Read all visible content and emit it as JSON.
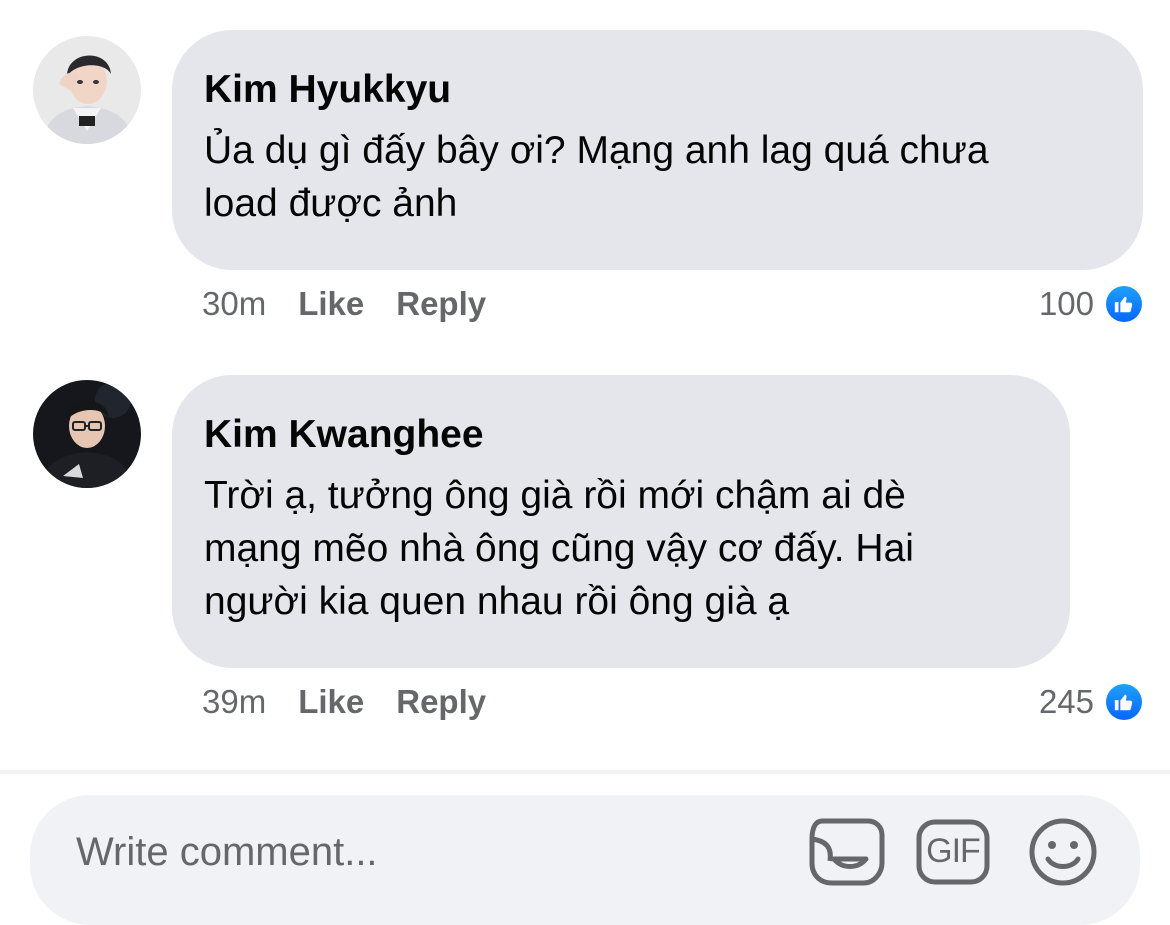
{
  "comments": [
    {
      "author": "Kim Hyukkyu",
      "text_lines": [
        "Ủa dụ gì đấy bây ơi? Mạng anh lag quá chưa",
        "load được ảnh"
      ],
      "time": "30m",
      "like_label": "Like",
      "reply_label": "Reply",
      "reaction_count": "100"
    },
    {
      "author": "Kim Kwanghee",
      "text_lines": [
        "Trời ạ, tưởng ông già rồi mới chậm ai dè",
        "mạng mẽo nhà ông cũng vậy cơ đấy. Hai",
        "người kia quen nhau rồi ông già ạ"
      ],
      "time": "39m",
      "like_label": "Like",
      "reply_label": "Reply",
      "reaction_count": "245"
    }
  ],
  "composer": {
    "placeholder": "Write comment...",
    "icons": [
      "sticker-icon",
      "gif-icon",
      "emoji-icon"
    ],
    "gif_label": "GIF"
  },
  "colors": {
    "bubble": "#e4e6eb",
    "meta_text": "#65676b",
    "like_blue": "#0866ff"
  }
}
